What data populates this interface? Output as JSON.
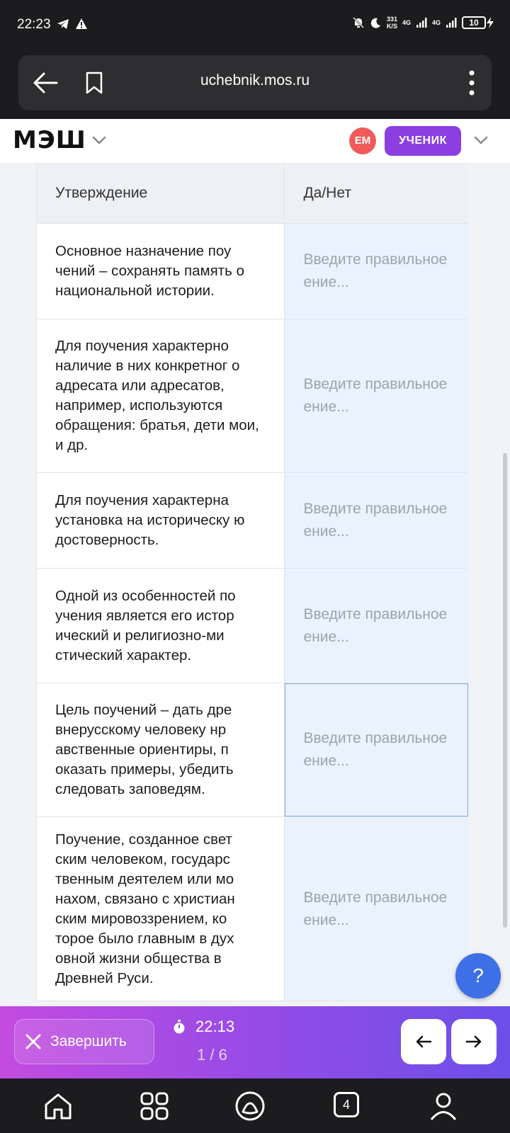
{
  "status_bar": {
    "time": "22:23",
    "net_rate_top": "331",
    "net_rate_bottom": "K/S",
    "net1": "4G",
    "net2": "4G",
    "battery": "10"
  },
  "browser": {
    "url": "uchebnik.mos.ru"
  },
  "app_header": {
    "logo": "МЭШ",
    "avatar_initials": "ЕМ",
    "role_label": "УЧЕНИК",
    "accent_color": "#8b3fe0",
    "avatar_color": "#f05a5a"
  },
  "table": {
    "headers": [
      "Утверждение",
      "Да/Нет"
    ],
    "placeholder": "Введите правильное значение...",
    "placeholder_line1": "Введите правильное",
    "placeholder_line2": "ение...",
    "rows": [
      {
        "text": "Основное назначение поу чений – сохранять память о национальной истории."
      },
      {
        "text": "Для поучения характерно наличие в них конкретног о адресата или адресатов, например, используются обращения: братья, дети мои, и др."
      },
      {
        "text": "Для поучения характерна установка на историческу ю достоверность."
      },
      {
        "text": "Одной из особенностей по учения является его истор ический и религиозно-ми стический характер."
      },
      {
        "text": "Цель поучений – дать дре внерусскому человеку нр авственные ориентиры, п оказать примеры, убедить следовать заповедям."
      },
      {
        "text": "Поучение, созданное свет ским человеком, государс твенным деятелем или мо нахом, связано с христиан ским мировоззрением, ко торое было главным в дух овной жизни общества в Древней Руси."
      }
    ]
  },
  "help_button": {
    "label": "?"
  },
  "action_bar": {
    "finish_label": "Завершить",
    "timer": "22:13",
    "progress": "1 / 6"
  },
  "system_nav": {
    "tabs_count": "4"
  }
}
